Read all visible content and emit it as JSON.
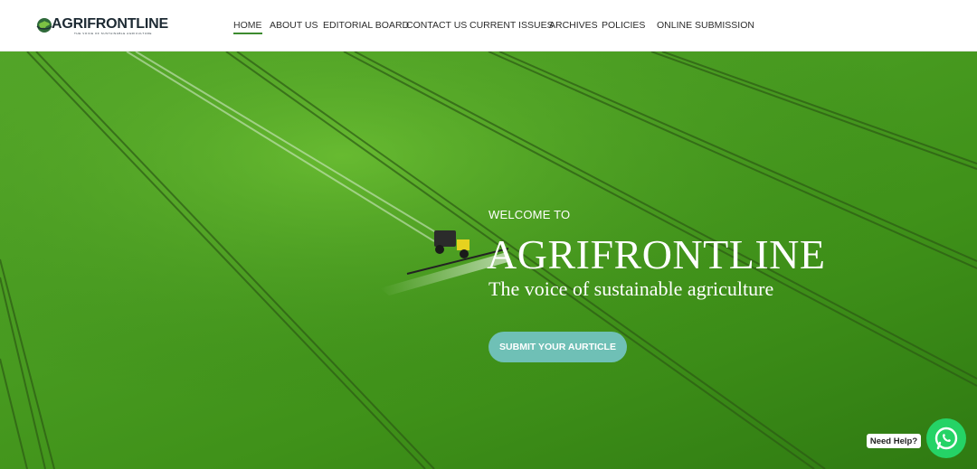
{
  "logo": {
    "name": "AGRIFRONTLINE",
    "tagline": "THE VOICE OF SUSTAINABLE AGRICULTURE"
  },
  "nav": {
    "items": [
      {
        "label": "HOME",
        "active": true
      },
      {
        "label": "ABOUT US"
      },
      {
        "label": "EDITORIAL BOARD"
      },
      {
        "label": "CONTACT US"
      },
      {
        "label": "CURRENT ISSUES"
      },
      {
        "label": "ARCHIVES"
      },
      {
        "label": "POLICIES"
      },
      {
        "label": "ONLINE SUBMISSION"
      }
    ]
  },
  "hero": {
    "welcome": "WELCOME TO",
    "title": "AGRIFRONTLINE",
    "subtitle": "The voice of sustainable agriculture",
    "button_label": "SUBMIT YOUR AURTICLE"
  },
  "help": {
    "bubble_text": "Need Help?",
    "icon": "whatsapp-icon"
  },
  "colors": {
    "accent": "#3d8b2f",
    "button": "#6fc0b6",
    "whatsapp": "#25d366"
  }
}
